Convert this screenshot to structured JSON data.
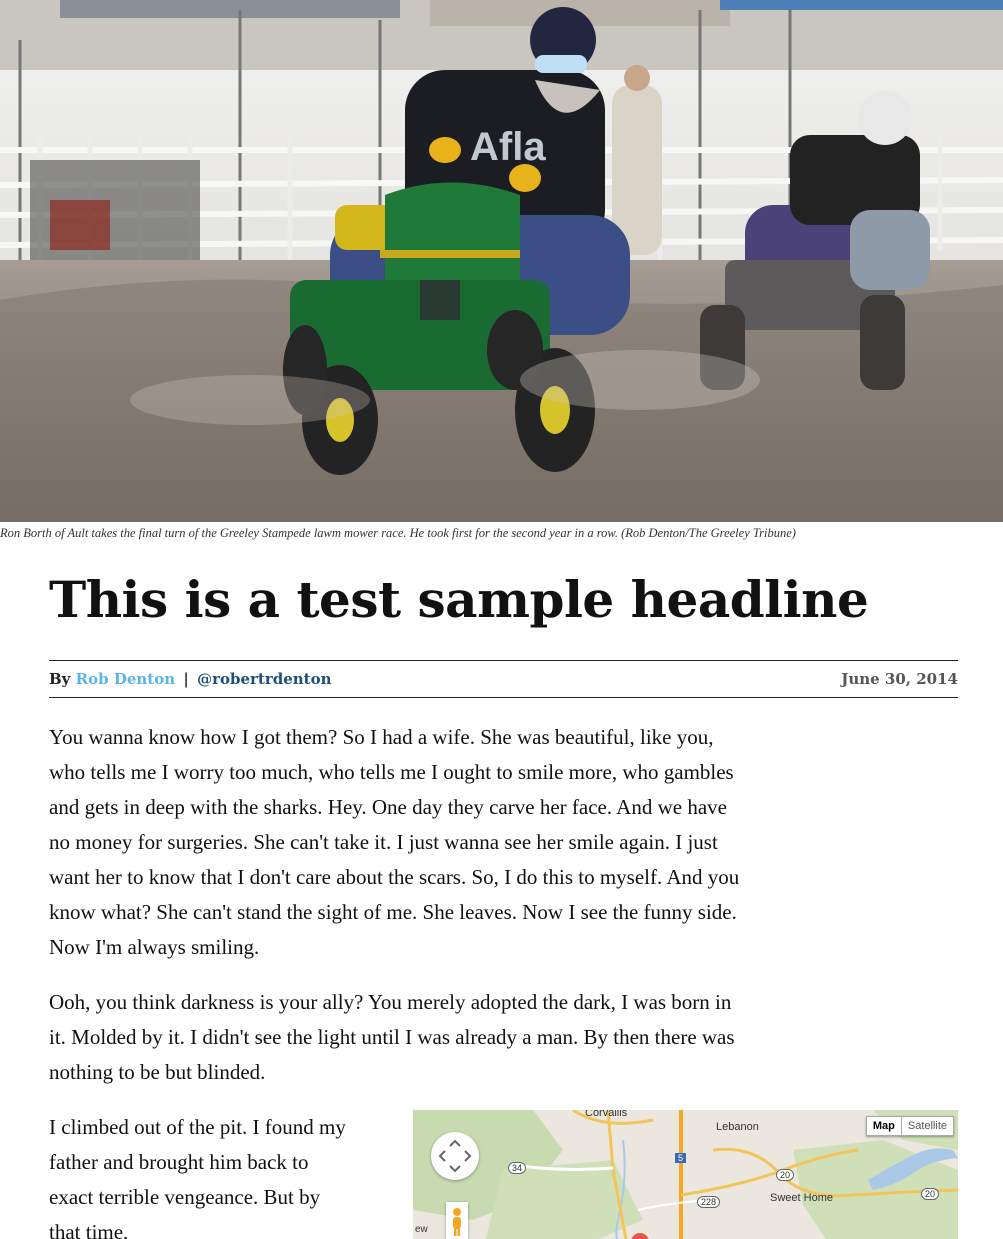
{
  "hero": {
    "caption": "Ron Borth of Ault takes the final turn of the Greeley Stampede lawm mower race. He took first for the second year in a row. (Rob Denton/The Greeley Tribune)"
  },
  "article": {
    "headline": "This is a test sample headline",
    "byline": {
      "by": "By",
      "author": "Rob Denton",
      "separator": "|",
      "handle": "@robertrdenton",
      "date": "June 30, 2014"
    },
    "paragraphs": [
      "You wanna know how I got them? So I had a wife. She was beautiful, like you, who tells me I worry too much, who tells me I ought to smile more, who gambles and gets in deep with the sharks. Hey. One day they carve her face. And we have no money for surgeries. She can't take it. I just wanna see her smile again. I just want her to know that I don't care about the scars. So, I do this to myself. And you know what? She can't stand the sight of me. She leaves. Now I see the funny side. Now I'm always smiling.",
      "Ooh, you think darkness is your ally? You merely adopted the dark, I was born in it. Molded by it. I didn't see the light until I was already a man. By then there was nothing to be but blinded.",
      "I climbed out of the pit. I found my father and brought him back to exact terrible vengeance. But by that time,"
    ]
  },
  "map": {
    "type_buttons": [
      "Map",
      "Satellite"
    ],
    "places": {
      "corvallis": "Corvallis",
      "lebanon": "Lebanon",
      "sweet_home": "Sweet Home"
    },
    "route_shields": {
      "r34": "34",
      "i5": "5",
      "r20a": "20",
      "r228": "228",
      "r20b": "20"
    },
    "edge_label": "ew",
    "icons": [
      "pan-control-icon",
      "pegman-icon",
      "map-pin-icon"
    ]
  }
}
